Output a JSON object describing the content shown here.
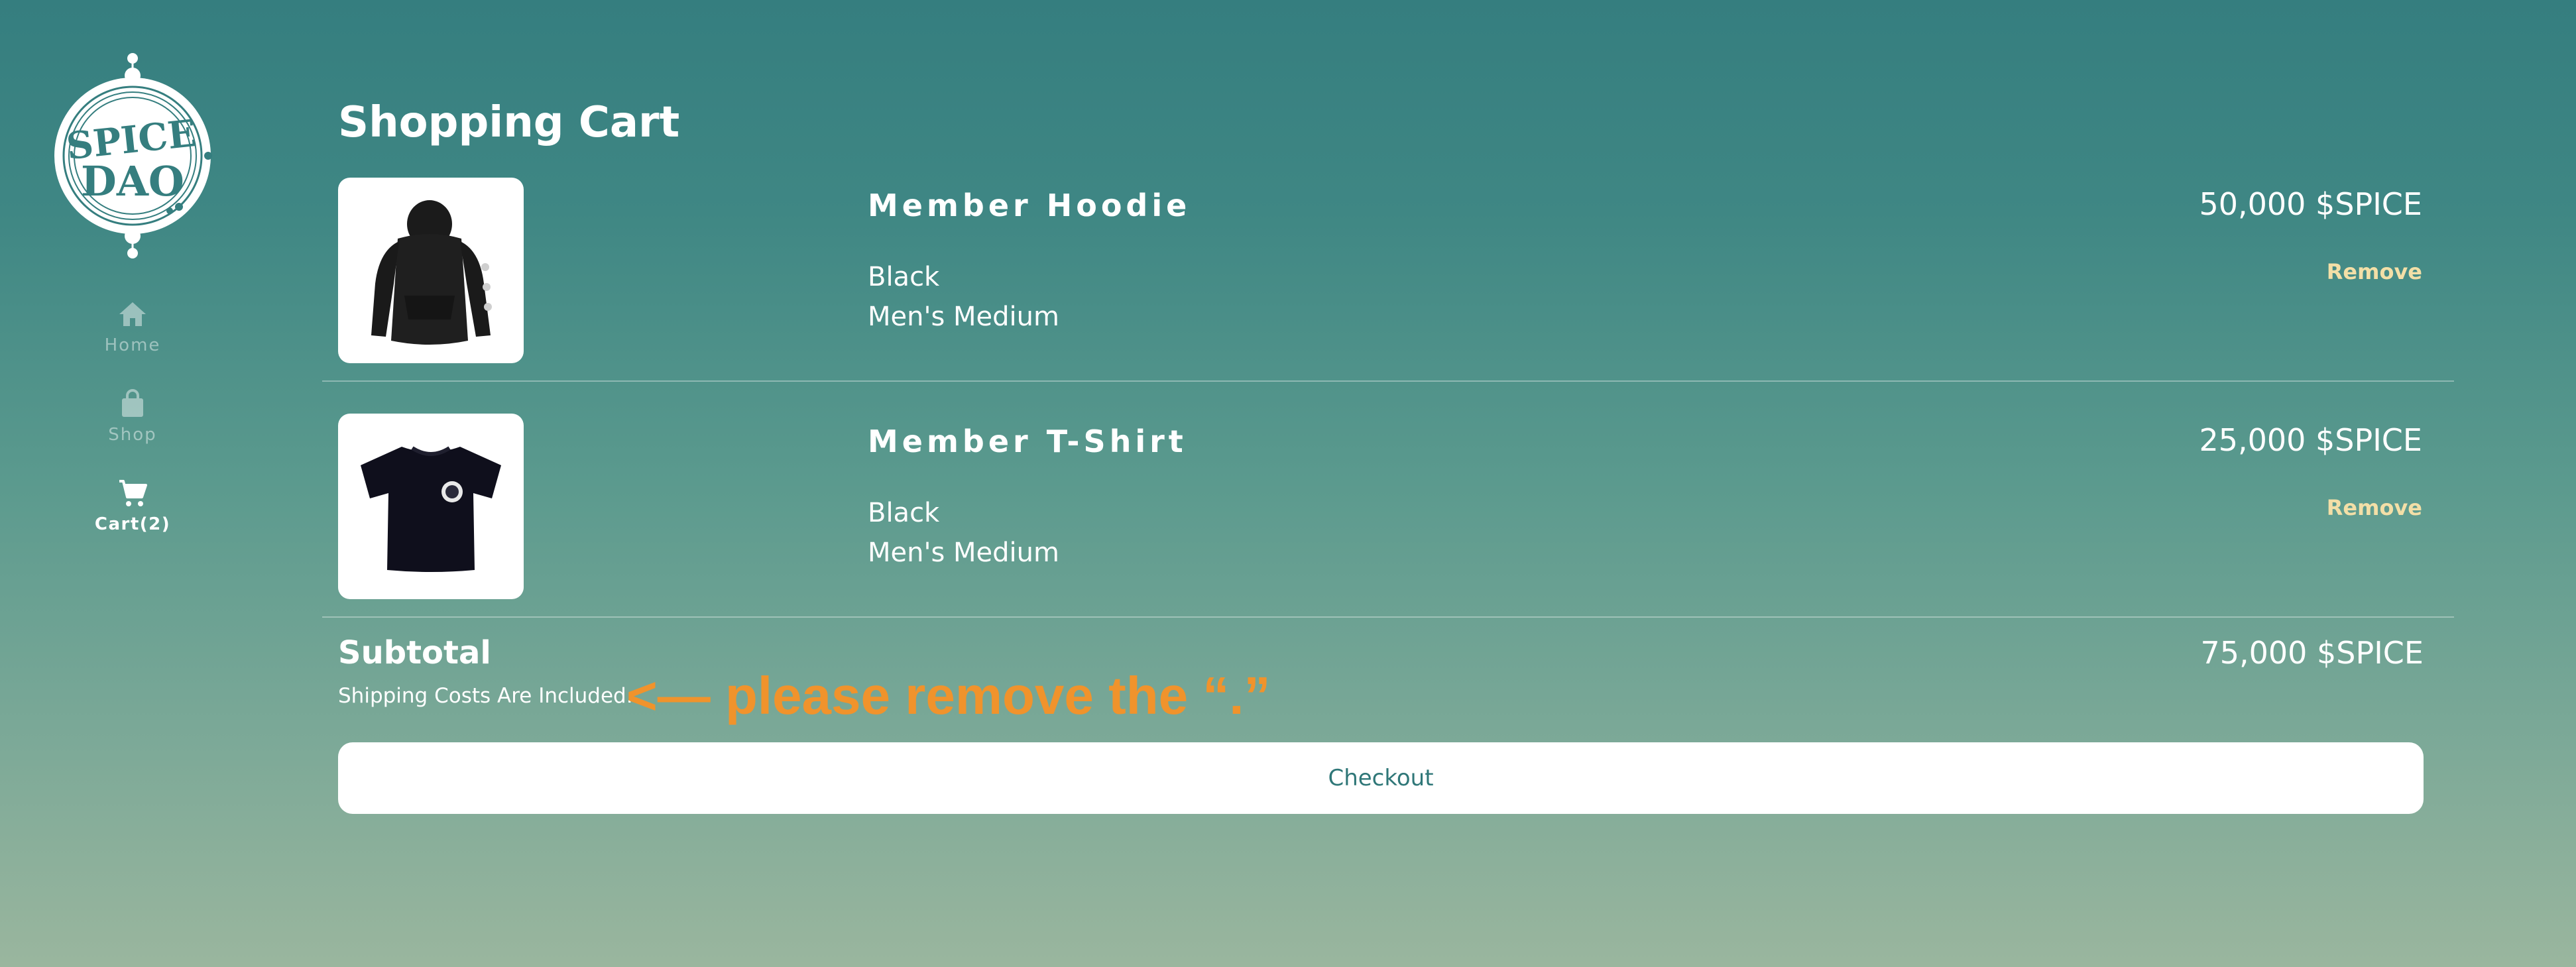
{
  "sidebar": {
    "logo_text": "SPICE DAO",
    "nav": [
      {
        "label": "Home",
        "icon": "home-icon"
      },
      {
        "label": "Shop",
        "icon": "shopping-bag-icon"
      },
      {
        "label": "Cart(2)",
        "icon": "cart-icon"
      }
    ]
  },
  "page": {
    "title": "Shopping Cart"
  },
  "cart": {
    "items": [
      {
        "name": "Member Hoodie",
        "color": "Black",
        "size": "Men's Medium",
        "price": "50,000 $SPICE",
        "remove_label": "Remove",
        "image_icon": "hoodie-image"
      },
      {
        "name": "Member T-Shirt",
        "color": "Black",
        "size": "Men's Medium",
        "price": "25,000 $SPICE",
        "remove_label": "Remove",
        "image_icon": "tshirt-image"
      }
    ],
    "subtotal_label": "Subtotal",
    "subtotal_value": "75,000 $SPICE",
    "shipping_note": "Shipping Costs Are Included.",
    "checkout_label": "Checkout"
  },
  "annotation": {
    "text": "<— please remove the “.”"
  },
  "colors": {
    "gradient_top": "#357e7f",
    "gradient_bottom": "#9ab69e",
    "remove_accent": "#f3dfa7",
    "annotation": "#f0932c",
    "button_text": "#2f7778"
  }
}
